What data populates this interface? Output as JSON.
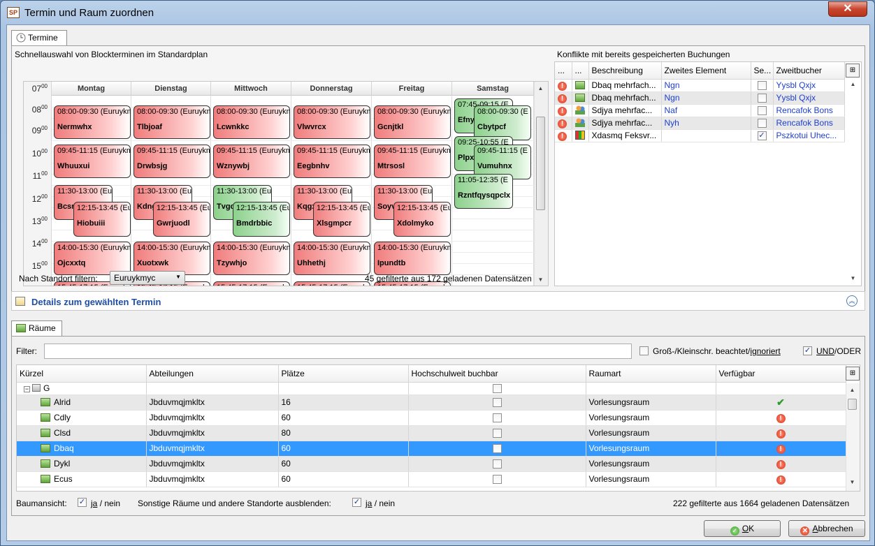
{
  "window": {
    "title": "Termin und Raum zuordnen",
    "app_icon": "SP",
    "close": "✕"
  },
  "termine_tab": {
    "label": "Termine"
  },
  "schnellauswahl": {
    "label": "Schnellauswahl von Blockterminen im Standardplan",
    "hours": [
      {
        "h": "07",
        "m": "00"
      },
      {
        "h": "08",
        "m": "00"
      },
      {
        "h": "09",
        "m": "00"
      },
      {
        "h": "10",
        "m": "00"
      },
      {
        "h": "11",
        "m": "00"
      },
      {
        "h": "12",
        "m": "00"
      },
      {
        "h": "13",
        "m": "00"
      },
      {
        "h": "14",
        "m": "00"
      },
      {
        "h": "15",
        "m": "00"
      }
    ],
    "days": [
      "Montag",
      "Dienstag",
      "Mittwoch",
      "Donnerstag",
      "Freitag",
      "Samstag"
    ],
    "events": {
      "mo": [
        {
          "time": "08:00-09:30 (Euruykmyc)",
          "name": "Nermwhx"
        },
        {
          "time": "09:45-11:15 (Euruykmyc)",
          "name": "Whuuxui"
        },
        {
          "time": "11:30-13:00 (Eu",
          "name": "Bcsr"
        },
        {
          "time": "12:15-13:45 (Eu",
          "name": "Hiobuiii"
        },
        {
          "time": "14:00-15:30 (Euruykmyc)",
          "name": "Ojcxxtq"
        },
        {
          "time": "15:45-17:15 (Euruykmyc)",
          "name": ""
        }
      ],
      "di": [
        {
          "time": "08:00-09:30 (Euruykmyc)",
          "name": "Tlbjoaf"
        },
        {
          "time": "09:45-11:15 (Euruykmyc)",
          "name": "Drwbsjg"
        },
        {
          "time": "11:30-13:00 (Eu",
          "name": "Kdng"
        },
        {
          "time": "12:15-13:45 (Eu",
          "name": "Gwrjuodl"
        },
        {
          "time": "14:00-15:30 (Euruykmyc)",
          "name": "Xuotxwk"
        },
        {
          "time": "15:45-17:15 (Euruykmyc)",
          "name": ""
        }
      ],
      "mi": [
        {
          "time": "08:00-09:30 (Euruykmyc)",
          "name": "Lcwnkkc"
        },
        {
          "time": "09:45-11:15 (Euruykmyc)",
          "name": "Wznywbj"
        },
        {
          "time": "11:30-13:00 (Eu",
          "name": "Tvgc"
        },
        {
          "time": "12:15-13:45 (Eu",
          "name": "Bmdrbbic"
        },
        {
          "time": "14:00-15:30 (Euruykmyc)",
          "name": "Tzywhjo"
        },
        {
          "time": "15:45-17:15 (Euruykmyc)",
          "name": ""
        }
      ],
      "do": [
        {
          "time": "08:00-09:30 (Euruykmyc)",
          "name": "Vlwvrcx"
        },
        {
          "time": "09:45-11:15 (Euruykmyc)",
          "name": "Eegbnhv"
        },
        {
          "time": "11:30-13:00 (Eu",
          "name": "Kqgx"
        },
        {
          "time": "12:15-13:45 (Eu",
          "name": "Xlsgmpcr"
        },
        {
          "time": "14:00-15:30 (Euruykmyc)",
          "name": "Uhhethj"
        },
        {
          "time": "15:45-17:15 (Euruykmyc)",
          "name": ""
        }
      ],
      "fr": [
        {
          "time": "08:00-09:30 (Euruykmyc)",
          "name": "Gcnjtkl"
        },
        {
          "time": "09:45-11:15 (Euruykmyc)",
          "name": "Mtrsosl"
        },
        {
          "time": "11:30-13:00 (Eu",
          "name": "Soyv"
        },
        {
          "time": "12:15-13:45 (Eu",
          "name": "Xdolmyko"
        },
        {
          "time": "14:00-15:30 (Euruykmyc)",
          "name": "Ipundtb"
        },
        {
          "time": "15:45-17:15 (Euruykmyc)",
          "name": ""
        }
      ],
      "sa": [
        {
          "time": "07:45-09:15 (E",
          "name": "Efny"
        },
        {
          "time": "08:00-09:30 (E",
          "name": "Cbytpcf"
        },
        {
          "time": "09:25-10:55 (E",
          "name": "Plpxl"
        },
        {
          "time": "09:45-11:15 (E",
          "name": "Vumuhnx"
        },
        {
          "time": "11:05-12:35 (E",
          "name": "Rzntfqysqpclx"
        }
      ]
    },
    "filter_label": "Nach Standort filtern:",
    "filter_value": "Euruykmyc",
    "count_text": "45 gefilterte aus 172 geladenen Datensätzen"
  },
  "konflikte": {
    "label": "Konflikte mit bereits gespeicherten Buchungen",
    "columns": [
      "...",
      "...",
      "Beschreibung",
      "Zweites Element",
      "Se...",
      "Zweitbucher"
    ],
    "rows": [
      {
        "icon": "room-icon",
        "beschreibung": "Dbaq mehrfach...",
        "zweites": "Ngn",
        "se": false,
        "zweitbucher": "Yysbl Qxjx"
      },
      {
        "icon": "room-icon",
        "beschreibung": "Dbaq mehrfach...",
        "zweites": "Ngn",
        "se": false,
        "zweitbucher": "Yysbl Qxjx"
      },
      {
        "icon": "people-icon",
        "beschreibung": "Sdjya mehrfac...",
        "zweites": "Naf",
        "se": false,
        "zweitbucher": "Rencafok Bons"
      },
      {
        "icon": "people-icon",
        "beschreibung": "Sdjya mehrfac...",
        "zweites": "Nyh",
        "se": false,
        "zweitbucher": "Rencafok Bons"
      },
      {
        "icon": "chart-icon",
        "beschreibung": "Xdasmq Feksvr...",
        "zweites": "",
        "se": true,
        "zweitbucher": "Pszkotui Uhec..."
      }
    ]
  },
  "details": {
    "label": "Details zum gewählten Termin"
  },
  "raeume_tab": {
    "label": "Räume"
  },
  "filter": {
    "label": "Filter:",
    "value": "",
    "case_pre": "Groß-/Kleinschr. beachtet/",
    "case_link": "ignoriert",
    "und_label": "UND",
    "oder_label": "/ODER"
  },
  "rooms": {
    "columns": [
      "Kürzel",
      "Abteilungen",
      "Plätze",
      "Hochschulweit buchbar",
      "Raumart",
      "Verfügbar"
    ],
    "group": "G",
    "rows": [
      {
        "kuerzel": "Alrid",
        "abt": "Jbduvmqjmkltx",
        "plaetze": "16",
        "art": "Vorlesungsraum",
        "ok": true
      },
      {
        "kuerzel": "Cdly",
        "abt": "Jbduvmqjmkltx",
        "plaetze": "60",
        "art": "Vorlesungsraum",
        "ok": false
      },
      {
        "kuerzel": "Clsd",
        "abt": "Jbduvmqjmkltx",
        "plaetze": "80",
        "art": "Vorlesungsraum",
        "ok": false
      },
      {
        "kuerzel": "Dbaq",
        "abt": "Jbduvmqjmkltx",
        "plaetze": "60",
        "art": "Vorlesungsraum",
        "ok": false
      },
      {
        "kuerzel": "Dykl",
        "abt": "Jbduvmqjmkltx",
        "plaetze": "60",
        "art": "Vorlesungsraum",
        "ok": false
      },
      {
        "kuerzel": "Ecus",
        "abt": "Jbduvmqjmkltx",
        "plaetze": "60",
        "art": "Vorlesungsraum",
        "ok": false
      }
    ],
    "selected_index": 3
  },
  "bottom": {
    "baum_label": "Baumansicht:",
    "ja": "ja",
    "nein": "/ nein",
    "sonstige_label": "Sonstige Räume und andere Standorte ausblenden:",
    "count_text": "222 gefilterte aus 1664 geladenen Datensätzen"
  },
  "buttons": {
    "ok_u": "O",
    "ok_rest": "K",
    "cancel_u": "A",
    "cancel_rest": "bbrechen"
  }
}
